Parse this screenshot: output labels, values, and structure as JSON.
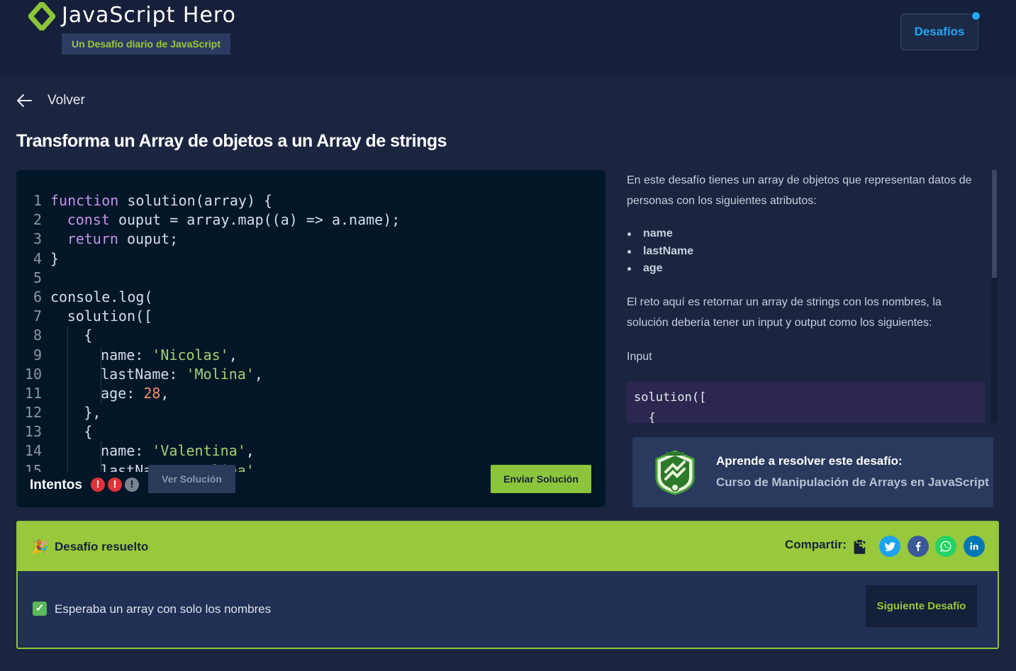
{
  "header": {
    "title": "JavaScript Hero",
    "subtitle": "Un Desafío diario de JavaScript",
    "desafios_label": "Desafíos"
  },
  "nav": {
    "back_label": "Volver"
  },
  "challenge": {
    "title": "Transforma un Array de objetos a un Array de strings"
  },
  "editor": {
    "lines": [
      {
        "n": "1",
        "depth": 0,
        "tokens": [
          {
            "t": "function",
            "c": "kw"
          },
          {
            "t": " solution(array) {",
            "c": ""
          }
        ]
      },
      {
        "n": "2",
        "depth": 1,
        "tokens": [
          {
            "t": "const",
            "c": "kw"
          },
          {
            "t": " ouput = array.map((a) => a.name);",
            "c": ""
          }
        ]
      },
      {
        "n": "3",
        "depth": 1,
        "tokens": [
          {
            "t": "return",
            "c": "kw"
          },
          {
            "t": " ouput;",
            "c": ""
          }
        ]
      },
      {
        "n": "4",
        "depth": 0,
        "tokens": [
          {
            "t": "}",
            "c": ""
          }
        ]
      },
      {
        "n": "5",
        "depth": 0,
        "tokens": []
      },
      {
        "n": "6",
        "depth": 0,
        "tokens": [
          {
            "t": "console.log(",
            "c": ""
          }
        ]
      },
      {
        "n": "7",
        "depth": 1,
        "tokens": [
          {
            "t": "solution([",
            "c": ""
          }
        ]
      },
      {
        "n": "8",
        "depth": 2,
        "tokens": [
          {
            "t": "{",
            "c": ""
          }
        ]
      },
      {
        "n": "9",
        "depth": 3,
        "tokens": [
          {
            "t": "name: ",
            "c": ""
          },
          {
            "t": "'Nicolas'",
            "c": "str"
          },
          {
            "t": ",",
            "c": ""
          }
        ]
      },
      {
        "n": "10",
        "depth": 3,
        "tokens": [
          {
            "t": "lastName: ",
            "c": ""
          },
          {
            "t": "'Molina'",
            "c": "str"
          },
          {
            "t": ",",
            "c": ""
          }
        ]
      },
      {
        "n": "11",
        "depth": 3,
        "tokens": [
          {
            "t": "age: ",
            "c": ""
          },
          {
            "t": "28",
            "c": "num"
          },
          {
            "t": ",",
            "c": ""
          }
        ]
      },
      {
        "n": "12",
        "depth": 2,
        "tokens": [
          {
            "t": "},",
            "c": ""
          }
        ]
      },
      {
        "n": "13",
        "depth": 2,
        "tokens": [
          {
            "t": "{",
            "c": ""
          }
        ]
      },
      {
        "n": "14",
        "depth": 3,
        "tokens": [
          {
            "t": "name: ",
            "c": ""
          },
          {
            "t": "'Valentina'",
            "c": "str"
          },
          {
            "t": ",",
            "c": ""
          }
        ]
      },
      {
        "n": "15",
        "depth": 3,
        "tokens": [
          {
            "t": "lastName: ",
            "c": ""
          },
          {
            "t": "'Molina'",
            "c": "str"
          },
          {
            "t": ",",
            "c": ""
          }
        ]
      }
    ],
    "attempts_label": "Intentos",
    "attempts": [
      "fail",
      "fail",
      "empty"
    ],
    "attempt_glyph": "!",
    "ver_solucion_label": "Ver Solución",
    "enviar_label": "Enviar Solución"
  },
  "description": {
    "intro": "En este desafío tienes un array de objetos que representan datos de personas con los siguientes atributos:",
    "attributes": [
      "name",
      "lastName",
      "age"
    ],
    "task": "El reto aquí es retornar un array de strings con los nombres, la solución debería tener un input y output como los siguientes:",
    "input_label": "Input",
    "input_code": "solution([\n  {"
  },
  "course": {
    "icon": "course-badge-icon",
    "title": "Aprende a resolver este desafío:",
    "link": "Curso de Manipulación de Arrays en JavaScript"
  },
  "result": {
    "icon": "🎉",
    "title": "Desafío resuelto",
    "share_label": "Compartir:",
    "share": [
      {
        "name": "clipboard-icon",
        "bg": "transparent"
      },
      {
        "name": "twitter-icon",
        "bg": "#1da1f2"
      },
      {
        "name": "facebook-icon",
        "bg": "#3b5998"
      },
      {
        "name": "whatsapp-icon",
        "bg": "#25d366"
      },
      {
        "name": "linkedin-icon",
        "bg": "#0077b5"
      }
    ],
    "check_glyph": "✓",
    "message": "Esperaba un array con solo los nombres",
    "next_label": "Siguiente Desafío"
  },
  "colors": {
    "accent_green": "#98c83c",
    "accent_blue": "#1ea7f2",
    "error_red": "#e0323a"
  }
}
